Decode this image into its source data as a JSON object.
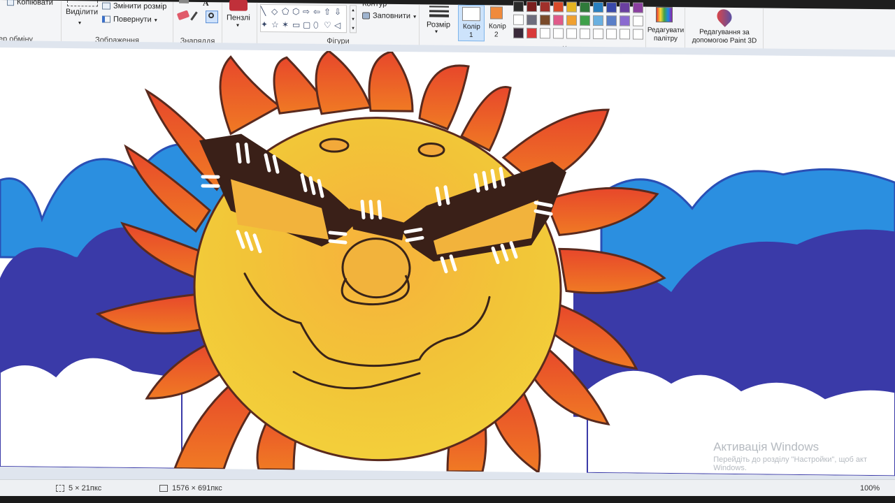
{
  "ribbon": {
    "clipboard": {
      "copy_label": "Копіювати",
      "group_label": "ер обміну"
    },
    "image": {
      "select_label": "Виділити",
      "resize_label": "Змінити розмір",
      "rotate_label": "Повернути",
      "group_label": "Зображення"
    },
    "tools": {
      "group_label": "Знаряддя",
      "text_icon_glyph": "A"
    },
    "brushes": {
      "label": "Пензлі"
    },
    "shapes": {
      "group_label": "Фігури",
      "outline_label": "Контур",
      "fill_label": "Заповнити",
      "glyphs": [
        "╲",
        "◇",
        "⬠",
        "⬡",
        "⇨",
        "⇦",
        "⇧",
        "⇩",
        "✦",
        "☆",
        "✶",
        "▭",
        "▢",
        "⬯",
        "♡",
        "◁"
      ]
    },
    "size": {
      "label": "Розмір"
    },
    "color1": {
      "label": "Колір",
      "number": "1",
      "value": "#ffffff"
    },
    "color2": {
      "label": "Колір",
      "number": "2",
      "value": "#f08a3c"
    },
    "palette": {
      "group_label": "Кольори",
      "rows": [
        [
          "#2b2b2b",
          "#7a1f1f",
          "#a0302a",
          "#d84b2a",
          "#e6b422",
          "#2f7a3a",
          "#2a7fbf",
          "#3949ab",
          "#6a3fa0",
          "#8a3fa0"
        ],
        [
          "#ffffff",
          "#6d6d7d",
          "#7a4a2a",
          "#e05a8a",
          "#f0a030",
          "#3fa04a",
          "#6ab0e0",
          "#5a7fc8",
          "#8a6ad0",
          "#ffffff"
        ],
        [
          "#3a2a3a",
          "#d83a3a",
          "#ffffff",
          "#ffffff",
          "#ffffff",
          "#ffffff",
          "#ffffff",
          "#ffffff",
          "#ffffff",
          "#ffffff"
        ]
      ]
    },
    "edit_colors": {
      "label_line1": "Редагувати",
      "label_line2": "палітру"
    },
    "paint3d": {
      "label_line1": "Редагування за",
      "label_line2": "допомогою Paint 3D"
    }
  },
  "status": {
    "selection_size": "5 × 21пкс",
    "canvas_size": "1576 × 691пкс",
    "zoom": "100%"
  },
  "watermark": {
    "title": "Активація Windows",
    "line1": "Перейдіть до розділу \"Настройки\", щоб акт",
    "line2": "Windows."
  }
}
